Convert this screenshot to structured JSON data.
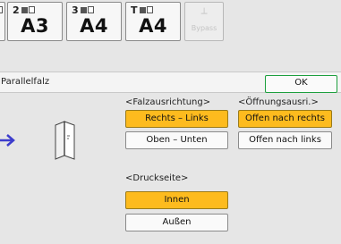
{
  "trays": [
    {
      "top": "2",
      "size": "A3"
    },
    {
      "top": "3",
      "size": "A4"
    },
    {
      "top": "T",
      "size": "A4"
    },
    {
      "label": "Bypass"
    }
  ],
  "header": {
    "title": "Parallelfalz",
    "ok_label": "OK"
  },
  "fold_direction": {
    "label": "<Falzausrichtung>",
    "options": [
      {
        "label": "Rechts – Links",
        "selected": true
      },
      {
        "label": "Oben – Unten",
        "selected": false
      }
    ]
  },
  "opening_direction": {
    "label": "<Öffnungsausri.>",
    "options": [
      {
        "label": "Offen nach rechts",
        "selected": true
      },
      {
        "label": "Offen nach links",
        "selected": false
      }
    ]
  },
  "print_side": {
    "label": "<Druckseite>",
    "options": [
      {
        "label": "Innen",
        "selected": true
      },
      {
        "label": "Außen",
        "selected": false
      }
    ]
  },
  "colors": {
    "selected": "#fdbb1e",
    "ok_border": "#1d9f3e",
    "arrow": "#3d3dcc"
  }
}
